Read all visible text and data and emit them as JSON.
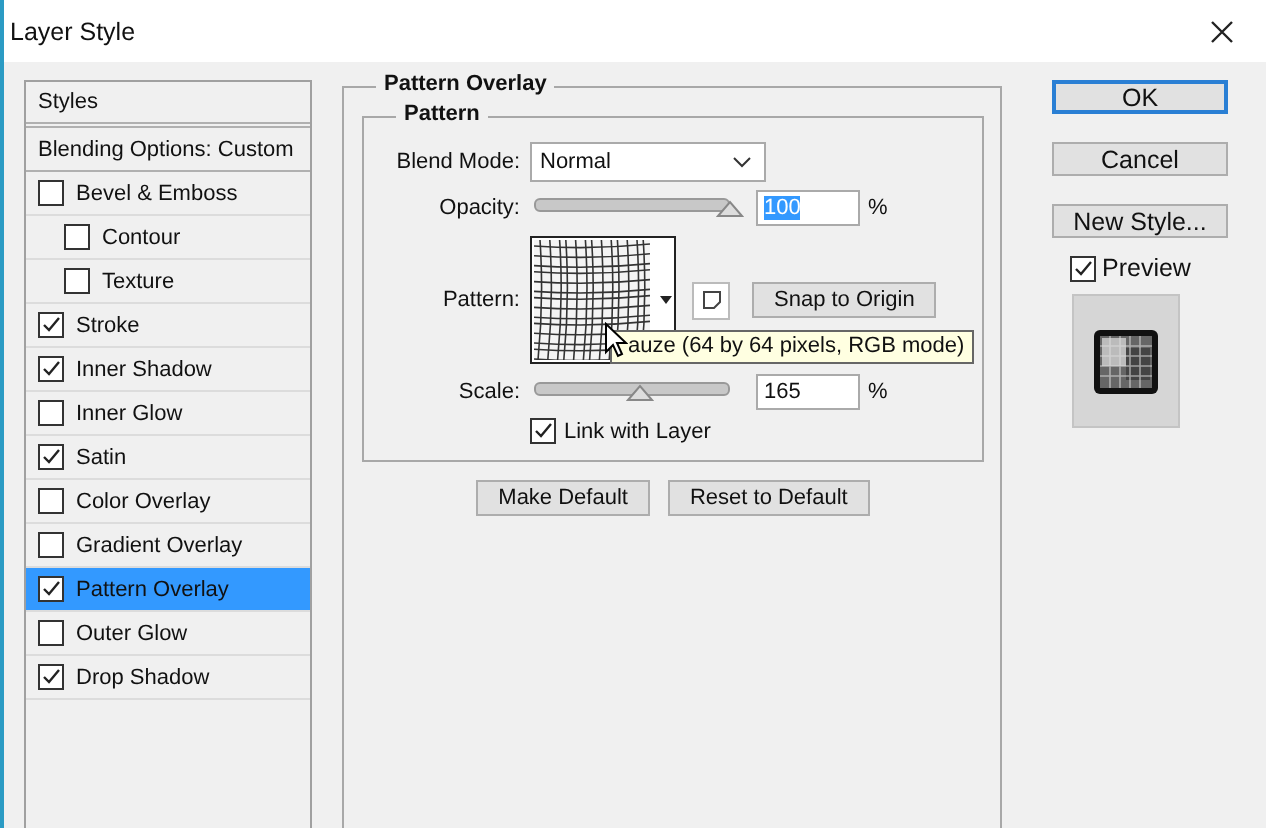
{
  "window": {
    "title": "Layer Style"
  },
  "sidebar": {
    "items": [
      {
        "kind": "header",
        "label": "Styles",
        "selected": false
      },
      {
        "kind": "header",
        "label": "Blending Options: Custom",
        "selected": false
      },
      {
        "kind": "effect",
        "label": "Bevel & Emboss",
        "checked": false,
        "selected": false,
        "children": [
          {
            "kind": "effect",
            "label": "Contour",
            "checked": false,
            "selected": false
          },
          {
            "kind": "effect",
            "label": "Texture",
            "checked": false,
            "selected": false
          }
        ]
      },
      {
        "kind": "effect",
        "label": "Stroke",
        "checked": true,
        "selected": false
      },
      {
        "kind": "effect",
        "label": "Inner Shadow",
        "checked": true,
        "selected": false
      },
      {
        "kind": "effect",
        "label": "Inner Glow",
        "checked": false,
        "selected": false
      },
      {
        "kind": "effect",
        "label": "Satin",
        "checked": true,
        "selected": false
      },
      {
        "kind": "effect",
        "label": "Color Overlay",
        "checked": false,
        "selected": false
      },
      {
        "kind": "effect",
        "label": "Gradient Overlay",
        "checked": false,
        "selected": false
      },
      {
        "kind": "effect",
        "label": "Pattern Overlay",
        "checked": true,
        "selected": true
      },
      {
        "kind": "effect",
        "label": "Outer Glow",
        "checked": false,
        "selected": false
      },
      {
        "kind": "effect",
        "label": "Drop Shadow",
        "checked": true,
        "selected": false
      }
    ]
  },
  "panel": {
    "title": "Pattern Overlay",
    "group_title": "Pattern",
    "blend_mode": {
      "label": "Blend Mode:",
      "value": "Normal"
    },
    "opacity": {
      "label": "Opacity:",
      "level": 1.0,
      "value": "100",
      "value_highlighted": true,
      "unit": "%"
    },
    "pattern": {
      "label": "Pattern:",
      "snap_button": "Snap to Origin",
      "tooltip": "auze (64 by 64 pixels, RGB mode)"
    },
    "scale": {
      "label": "Scale:",
      "level": 0.54,
      "value": "165",
      "value_highlighted": false,
      "unit": "%"
    },
    "link_with_layer": {
      "label": "Link with Layer",
      "checked": true
    },
    "buttons": [
      "Make Default",
      "Reset to Default"
    ]
  },
  "actions": {
    "buttons": [
      {
        "label": "OK",
        "default": true
      },
      {
        "label": "Cancel",
        "default": false
      },
      {
        "label": "New Style...",
        "default": false
      }
    ],
    "preview": {
      "label": "Preview",
      "checked": true
    }
  }
}
